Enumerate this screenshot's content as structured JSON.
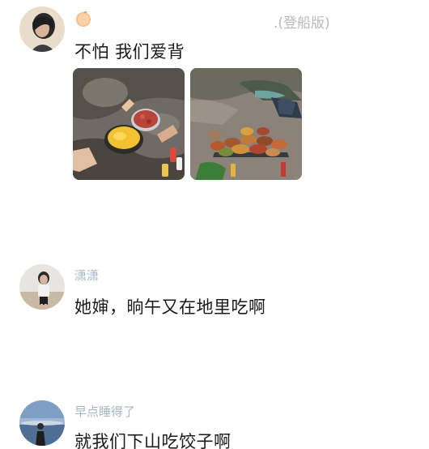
{
  "post": {
    "edition_label": ".(登船版)",
    "text": "不怕 我们爱背",
    "avatar_icon": "user-avatar-icon",
    "badge_icon": "orange-fruit-icon",
    "photos": [
      {
        "subject": "cooking-on-rocks-photo"
      },
      {
        "subject": "picnic-spread-photo"
      }
    ]
  },
  "comments": [
    {
      "username": "潇潇",
      "text": "她婶，晌午又在地里吃啊"
    },
    {
      "username": "早点睡得了",
      "text": "就我们下山吃饺子啊"
    }
  ],
  "colors": {
    "username": "#a8b7c6",
    "body_text": "#1a1a1a",
    "edition": "#b8b8b8",
    "background": "#ffffff"
  }
}
